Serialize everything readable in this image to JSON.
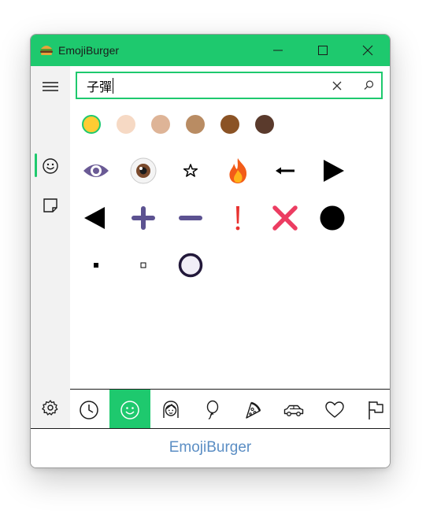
{
  "window": {
    "title": "EmojiBurger",
    "icon": "burger-icon",
    "controls": [
      "minimize-icon",
      "maximize-icon",
      "close-icon"
    ],
    "accent_color": "#1ec96e"
  },
  "sidebar": {
    "items": [
      {
        "name": "menu",
        "icon": "hamburger-menu-icon"
      },
      {
        "name": "emoji",
        "icon": "smiley-icon",
        "active": true
      },
      {
        "name": "sticky-note",
        "icon": "note-icon"
      },
      {
        "name": "settings",
        "icon": "gear-icon"
      }
    ]
  },
  "search": {
    "value": "子彈",
    "clear_icon": "clear-icon",
    "search_icon": "search-icon"
  },
  "skin_tones": {
    "selected_index": 0,
    "colors": [
      "#ffcc33",
      "#f6d9c4",
      "#deb497",
      "#b98c63",
      "#8b5325",
      "#5a3a2c"
    ]
  },
  "results": [
    {
      "icon": "eye-icon"
    },
    {
      "icon": "eyeball-icon"
    },
    {
      "icon": "star-outline-icon"
    },
    {
      "icon": "fire-icon"
    },
    {
      "icon": "left-arrow-icon"
    },
    {
      "icon": "play-right-triangle-icon"
    },
    {
      "icon": "play-left-triangle-icon"
    },
    {
      "icon": "plus-icon"
    },
    {
      "icon": "minus-icon"
    },
    {
      "icon": "exclamation-icon"
    },
    {
      "icon": "cross-mark-icon"
    },
    {
      "icon": "black-circle-icon"
    },
    {
      "icon": "small-black-square-icon"
    },
    {
      "icon": "small-white-square-icon"
    },
    {
      "icon": "heavy-circle-icon"
    }
  ],
  "category_tabs": [
    {
      "name": "recent",
      "icon": "clock-icon"
    },
    {
      "name": "smileys",
      "icon": "smiley-icon",
      "active": true
    },
    {
      "name": "people",
      "icon": "person-icon"
    },
    {
      "name": "nature",
      "icon": "balloon-icon"
    },
    {
      "name": "food",
      "icon": "pizza-icon"
    },
    {
      "name": "travel",
      "icon": "car-icon"
    },
    {
      "name": "symbols",
      "icon": "heart-icon"
    },
    {
      "name": "flags",
      "icon": "flag-icon"
    }
  ],
  "footer": {
    "brand": "EmojiBurger",
    "brand_color": "#5b8ec4"
  }
}
